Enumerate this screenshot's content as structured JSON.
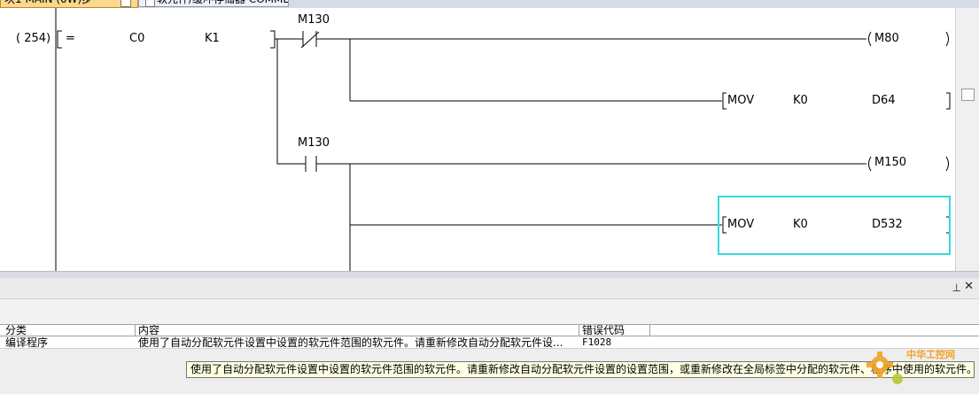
{
  "tabs": [
    {
      "label": "块1 MAIN (0W)步"
    },
    {
      "label": "软元件/缓冲存储器 COMMENT"
    }
  ],
  "ladder": {
    "step_number": "( 254)",
    "compare": {
      "op": "=",
      "op1": "C0",
      "op2": "K1"
    },
    "rungs": [
      {
        "contact": "M130",
        "contact_type": "nc",
        "coil": "M80"
      },
      {
        "instr": "MOV",
        "src": "K0",
        "dst": "D64"
      },
      {
        "contact": "M130",
        "contact_type": "no",
        "coil": "M150"
      },
      {
        "instr": "MOV",
        "src": "K0",
        "dst": "D532"
      }
    ]
  },
  "panel": {
    "pin_glyph": "⊥",
    "close_glyph": "✕"
  },
  "grid": {
    "columns": [
      "分类",
      "内容",
      "错误代码"
    ],
    "rows": [
      {
        "category": "编译程序",
        "content": "使用了自动分配软元件设置中设置的软元件范围的软元件。请重新修改自动分配软元件设...",
        "code": "F1028"
      }
    ]
  },
  "tooltip": {
    "text": "使用了自动分配软元件设置中设置的软元件范围的软元件。请重新修改自动分配软元件设置的设置范围，或重新修改在全局标签中分配的软元件、程序中使用的软元件。"
  },
  "watermark": {
    "text": "中华工控网"
  },
  "colors": {
    "selection": "#38d6dc",
    "tab_active": "#fbd88d",
    "tooltip_bg": "#ffffe1"
  }
}
